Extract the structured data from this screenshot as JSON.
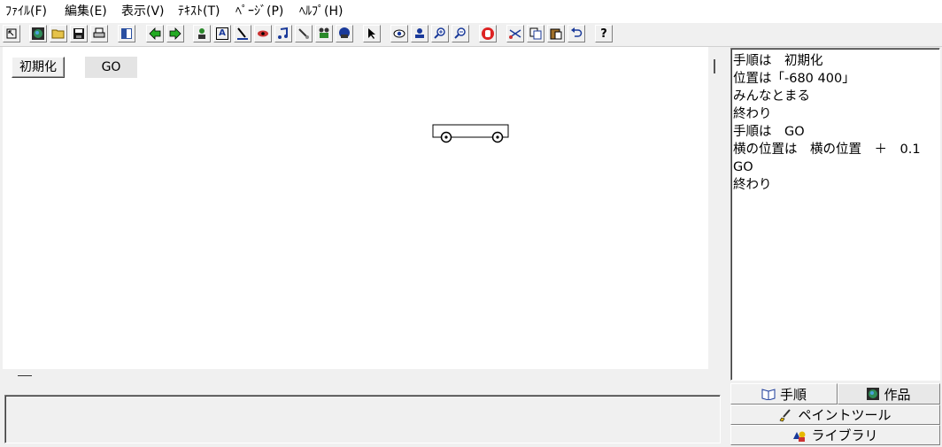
{
  "menu": {
    "file": "ﾌｧｲﾙ(F)",
    "edit": "編集(E)",
    "view": "表示(V)",
    "text": "ﾃｷｽﾄ(T)",
    "page": "ﾍﾟｰｼﾞ(P)",
    "help": "ﾍﾙﾌﾟ(H)"
  },
  "toolbar": {
    "help_label": "?",
    "text_label": "A"
  },
  "stage": {
    "init_button_label": "初期化",
    "go_button_label": "GO"
  },
  "script": {
    "lines": [
      "手順は　初期化",
      "位置は「-680 400」",
      "みんなとまる",
      "終わり",
      "手順は　GO",
      "横の位置は　横の位置　＋　0.1",
      "GO",
      "終わり"
    ]
  },
  "tabs": {
    "script": "手順",
    "works": "作品",
    "paint_tool": "ペイントツール",
    "library": "ライブラリ"
  }
}
